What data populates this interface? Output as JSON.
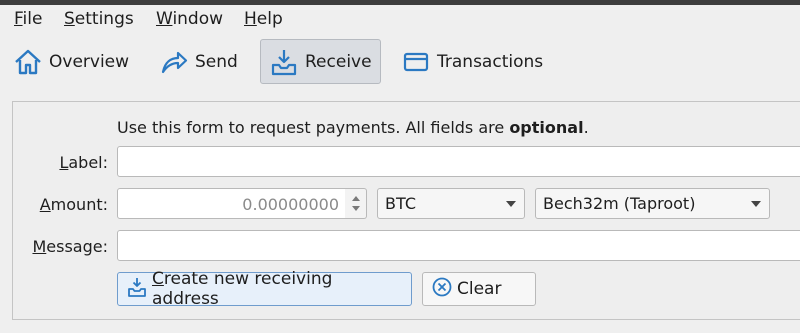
{
  "menu": {
    "file": {
      "key": "F",
      "rest": "ile"
    },
    "settings": {
      "key": "S",
      "rest": "ettings"
    },
    "window": {
      "key": "W",
      "rest": "indow"
    },
    "help": {
      "key": "H",
      "rest": "elp"
    }
  },
  "toolbar": {
    "overview": "Overview",
    "send": "Send",
    "receive": "Receive",
    "transactions": "Transactions",
    "icons": [
      "home-icon",
      "send-arrow-icon",
      "receive-inbox-icon",
      "card-icon"
    ],
    "accent": "#2b79c2"
  },
  "form": {
    "intro_prefix": "Use this form to request payments. All fields are ",
    "intro_bold": "optional",
    "intro_suffix": ".",
    "label": {
      "key": "L",
      "rest": "abel:",
      "value": ""
    },
    "amount": {
      "key": "A",
      "rest": "mount:",
      "value": "0.00000000"
    },
    "message": {
      "key": "M",
      "rest": "essage:",
      "value": ""
    },
    "unit": "BTC",
    "address_type": "Bech32m (Taproot)",
    "create_button": {
      "key": "C",
      "rest": "reate new receiving address"
    },
    "clear_button": "Clear"
  }
}
